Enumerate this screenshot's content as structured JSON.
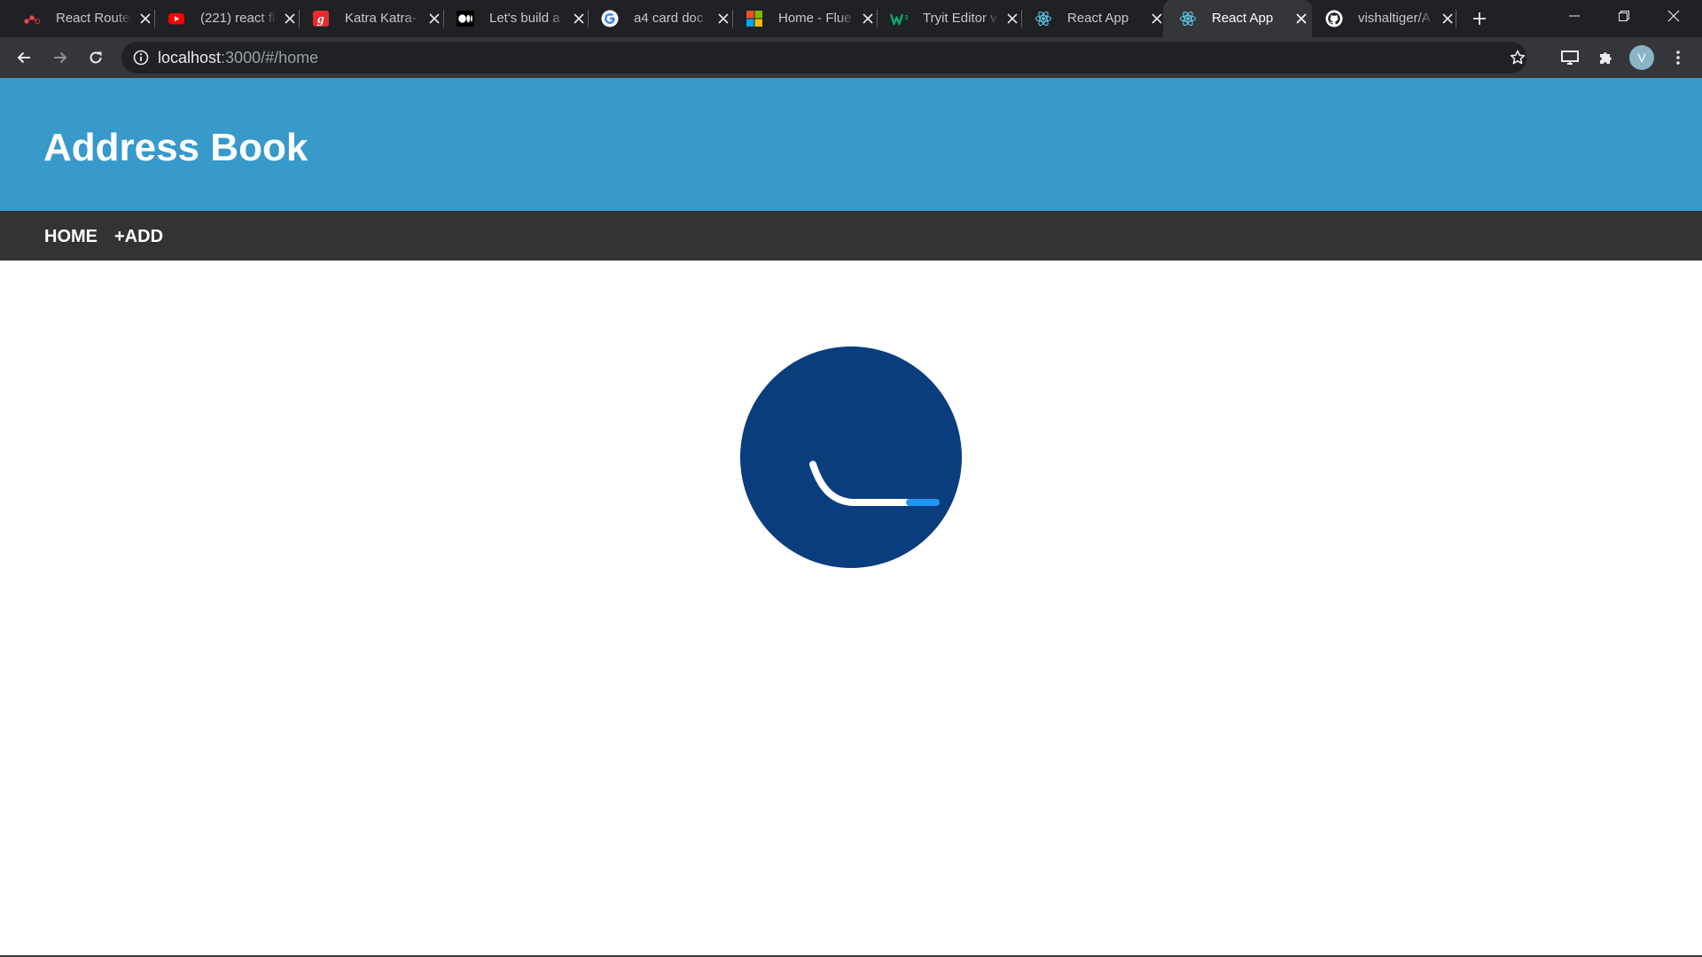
{
  "browser": {
    "tabs": [
      {
        "title": "React Router",
        "icon": "react-router-icon"
      },
      {
        "title": "(221) react fl",
        "icon": "youtube-icon"
      },
      {
        "title": "Katra Katra-",
        "icon": "gaana-icon"
      },
      {
        "title": "Let's build a",
        "icon": "medium-icon"
      },
      {
        "title": "a4 card doc",
        "icon": "google-icon"
      },
      {
        "title": "Home - Flue",
        "icon": "microsoft-icon"
      },
      {
        "title": "Tryit Editor v",
        "icon": "w3schools-icon"
      },
      {
        "title": "React App",
        "icon": "react-icon"
      },
      {
        "title": "React App",
        "icon": "react-icon",
        "active": true
      },
      {
        "title": "vishaltiger/A",
        "icon": "github-icon"
      }
    ],
    "url": {
      "host": "localhost",
      "path": ":3000/#/home"
    },
    "profile_initial": "V"
  },
  "app": {
    "title": "Address Book",
    "nav": {
      "home": "HOME",
      "add": "+ADD"
    }
  },
  "colors": {
    "header": "#3899cb",
    "nav": "#333333",
    "spinner_bg": "#0a3d7e",
    "spinner_track": "#ffffff",
    "spinner_accent": "#2196f3"
  }
}
